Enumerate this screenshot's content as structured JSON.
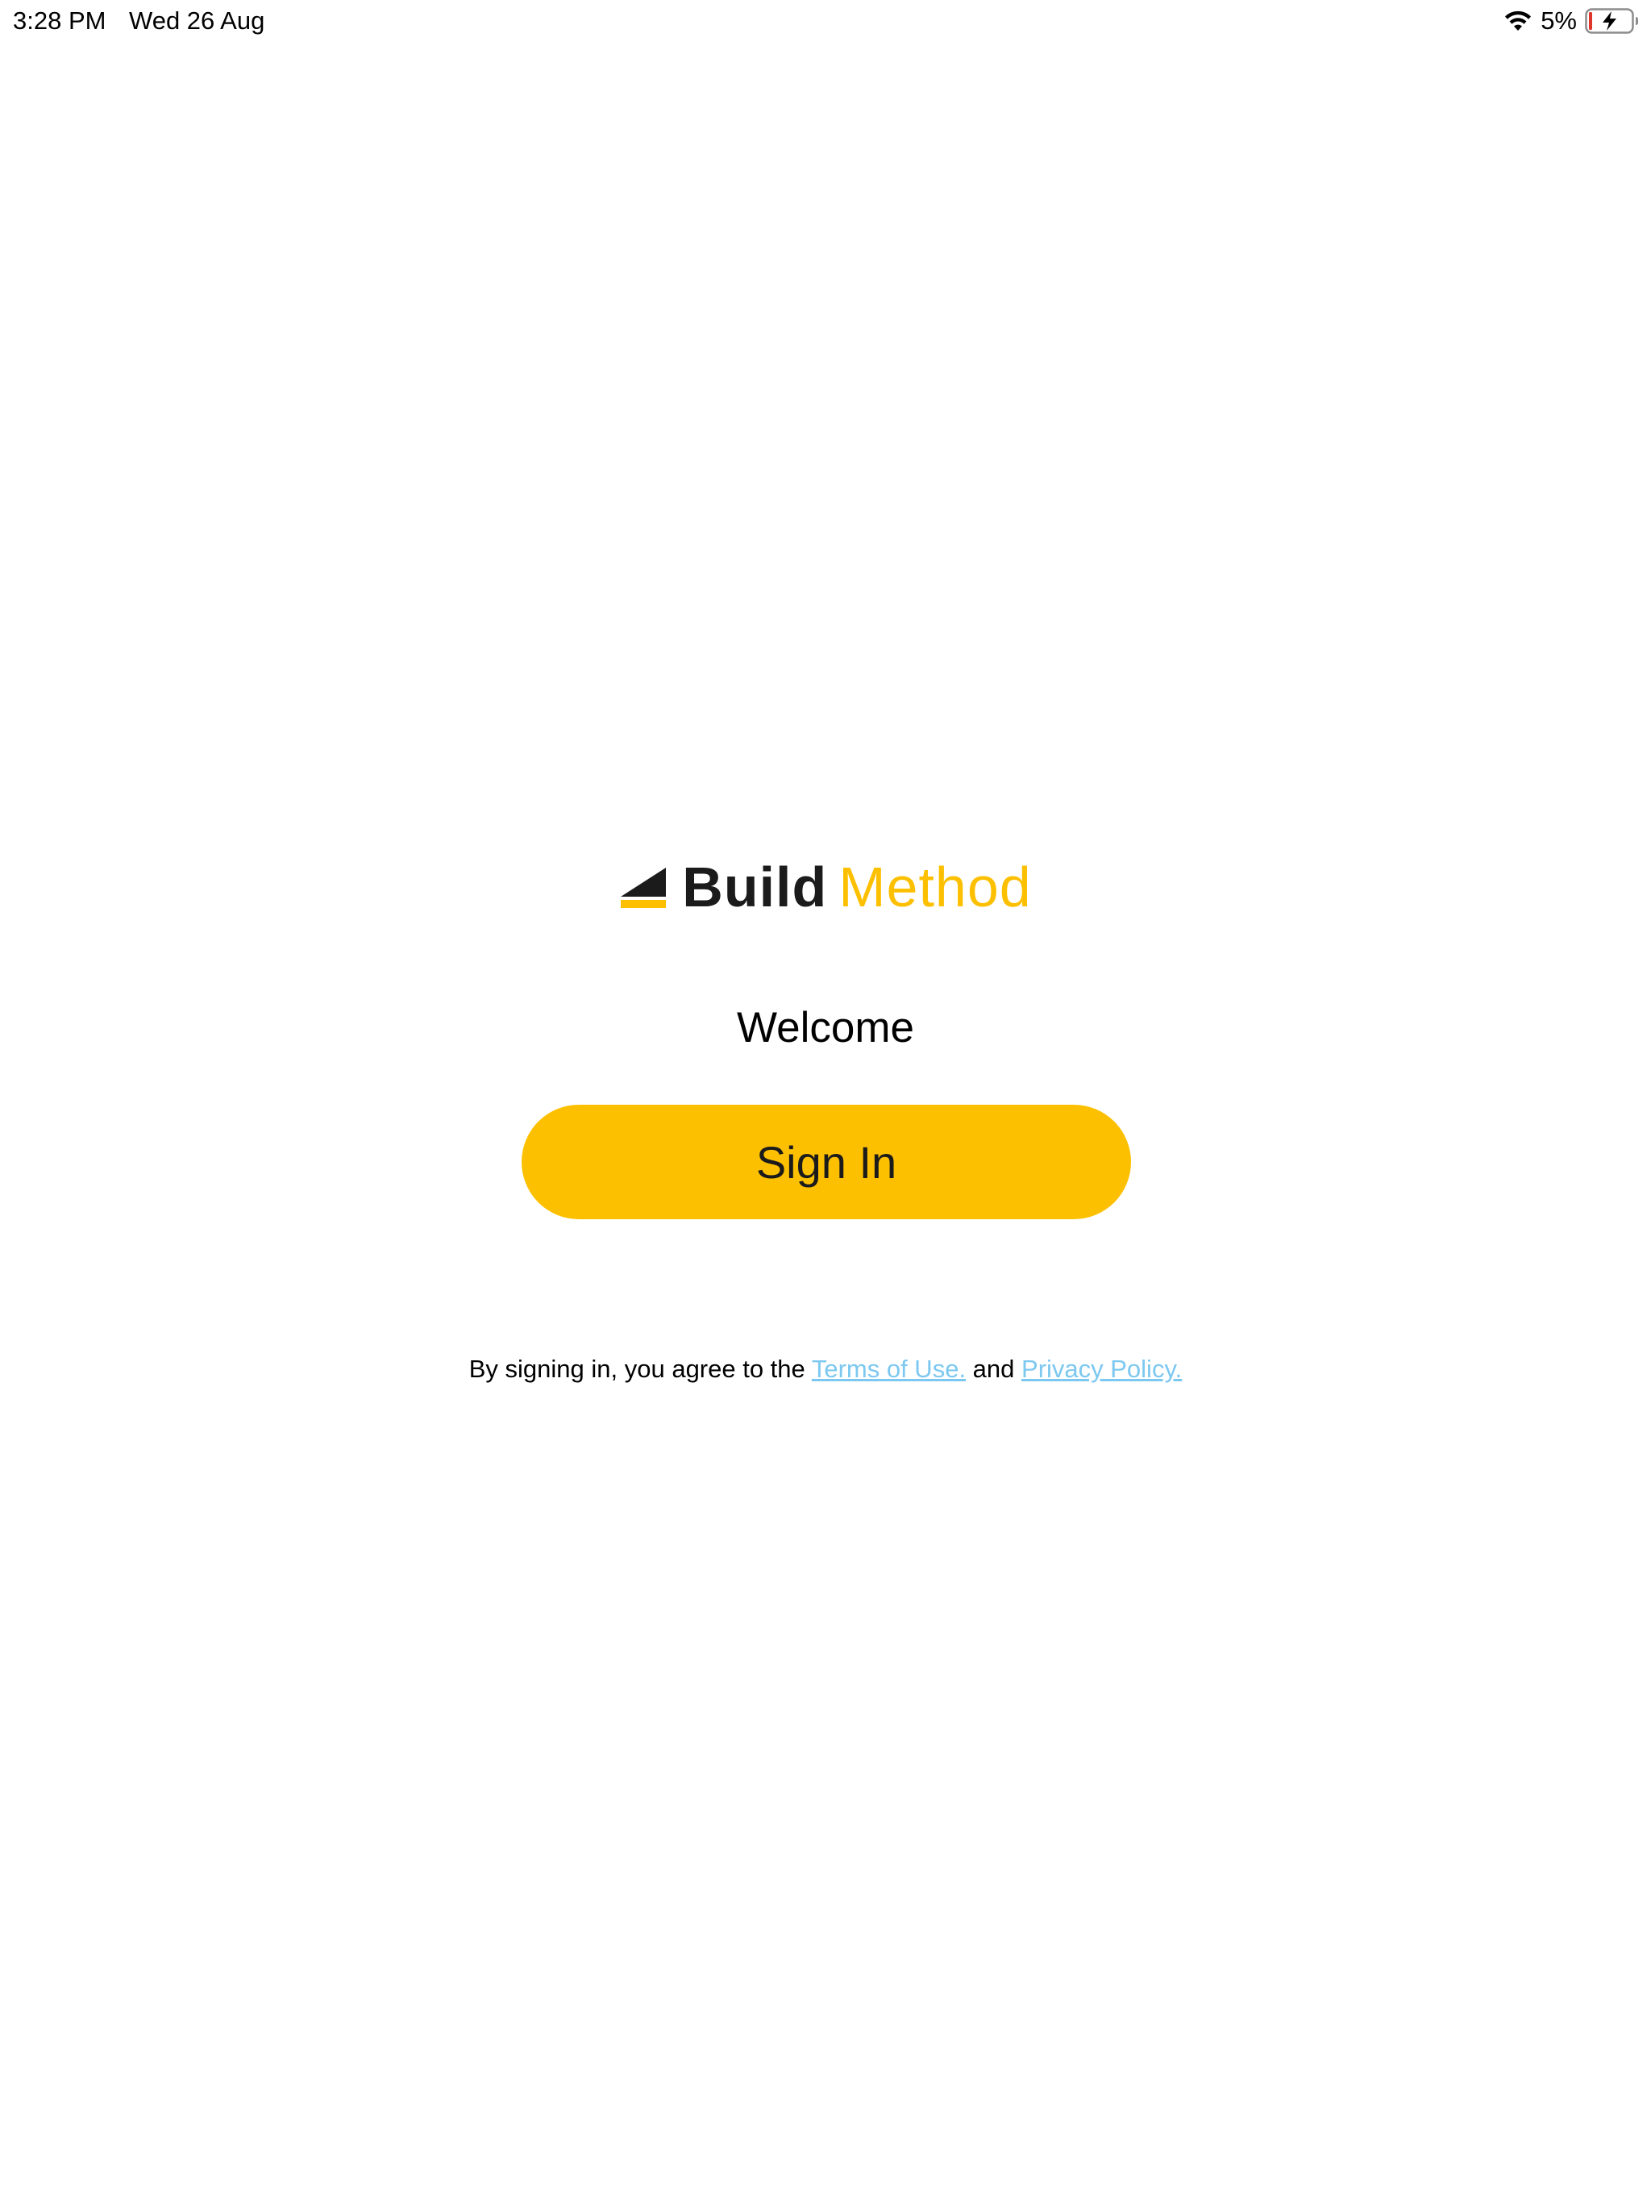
{
  "status_bar": {
    "time": "3:28 PM",
    "date": "Wed 26 Aug",
    "wifi_icon": "wifi-icon",
    "battery_percent": "5%",
    "battery_icon": "battery-charging-icon"
  },
  "logo": {
    "mark_icon": "build-method-logo-mark",
    "word_1": "Build",
    "word_2": "Method"
  },
  "welcome": {
    "title": "Welcome"
  },
  "sign_in": {
    "label": "Sign In"
  },
  "legal": {
    "prefix": "By signing in, you agree to the ",
    "terms_link": "Terms of Use.",
    "middle": " and ",
    "privacy_link": "Privacy Policy."
  },
  "colors": {
    "accent": "#fdc000",
    "link": "#7cc8f0",
    "text": "#1b1b1b",
    "background": "#ffffff",
    "battery_low": "#e0352b"
  }
}
